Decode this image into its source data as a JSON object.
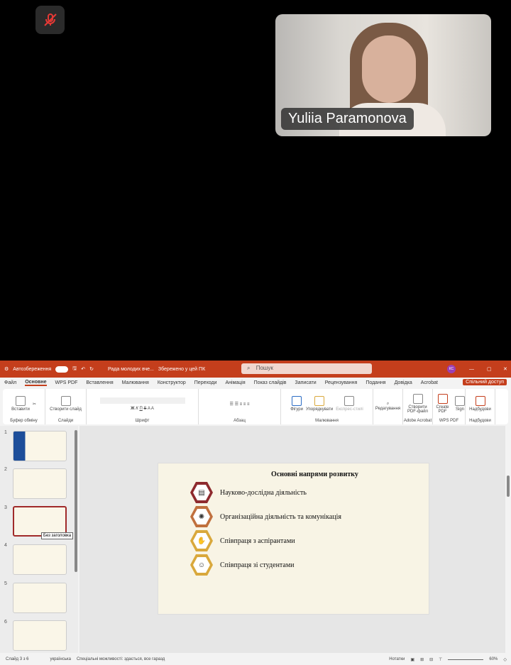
{
  "meeting": {
    "participant_name": "Yuliia Paramonova",
    "mic_state": "muted"
  },
  "ppt": {
    "autosave_label": "Автозбереження",
    "doc_title": "Рада молодих вче...",
    "save_status": "Збережено у цей ПК",
    "search_placeholder": "Пошук",
    "user_initials": "КС",
    "share_label": "Спільний доступ",
    "tabs": [
      "Файл",
      "Основне",
      "WPS PDF",
      "Вставлення",
      "Малювання",
      "Конструктор",
      "Переходи",
      "Анімація",
      "Показ слайдів",
      "Записати",
      "Рецензування",
      "Подання",
      "Довідка",
      "Acrobat"
    ],
    "ribbon_groups": [
      {
        "name": "Буфер обміну",
        "buttons": [
          "Вставити"
        ]
      },
      {
        "name": "Слайди",
        "buttons": [
          "Створити слайд"
        ]
      },
      {
        "name": "Шрифт",
        "buttons": [
          "Ж",
          "К",
          "П",
          "S"
        ]
      },
      {
        "name": "Абзац",
        "buttons": []
      },
      {
        "name": "Малювання",
        "buttons": [
          "Фігури",
          "Упорядкувати",
          "Експрес-стилі"
        ]
      },
      {
        "name": "",
        "buttons": [
          "Редагування"
        ]
      },
      {
        "name": "Adobe Acrobat",
        "buttons": [
          "Створити PDF-файл"
        ]
      },
      {
        "name": "WPS PDF",
        "buttons": [
          "Create PDF",
          "Sign"
        ]
      },
      {
        "name": "Надбудови",
        "buttons": [
          "Надбудови"
        ]
      }
    ],
    "thumbnails": [
      "1",
      "2",
      "3",
      "4",
      "5",
      "6"
    ],
    "thumb_tooltip": "Без заголовка",
    "slide": {
      "title": "Основні напрями розвитку",
      "items": [
        {
          "text": "Науково-дослідна діяльність",
          "color": "#8e2a2e",
          "icon": "clipboard-icon"
        },
        {
          "text": "Організаційна діяльність та комунікація",
          "color": "#c0703e",
          "icon": "lightbulb-icon"
        },
        {
          "text": "Співпраця з аспірантами",
          "color": "#d9a83c",
          "icon": "handshake-icon"
        },
        {
          "text": "Співпраця зі студентами",
          "color": "#d9a83c",
          "icon": "people-icon"
        }
      ]
    },
    "status": {
      "slide_counter": "Слайд 3 з 6",
      "language": "українська",
      "accessibility": "Спеціальні можливості: здається, все гаразд",
      "notes": "Нотатки",
      "zoom": "60%"
    }
  }
}
